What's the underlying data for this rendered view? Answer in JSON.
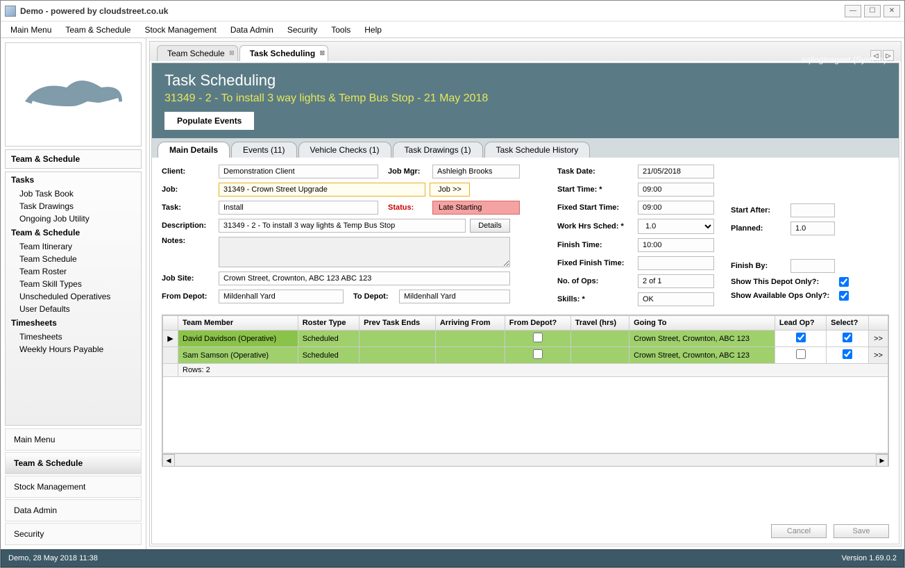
{
  "window": {
    "title": "Demo - powered by cloudstreet.co.uk"
  },
  "menu": [
    "Main Menu",
    "Team & Schedule",
    "Stock Management",
    "Data Admin",
    "Security",
    "Tools",
    "Help"
  ],
  "sidebar": {
    "title": "Team & Schedule",
    "groups": [
      {
        "title": "Tasks",
        "items": [
          "Job Task Book",
          "Task Drawings",
          "Ongoing Job Utility"
        ]
      },
      {
        "title": "Team & Schedule",
        "items": [
          "Team Itinerary",
          "Team Schedule",
          "Team Roster",
          "Team Skill Types",
          "Unscheduled Operatives",
          "User Defaults"
        ]
      },
      {
        "title": "Timesheets",
        "items": [
          "Timesheets",
          "Weekly Hours Payable"
        ]
      }
    ],
    "bottom": [
      "Main Menu",
      "Team & Schedule",
      "Stock Management",
      "Data Admin",
      "Security"
    ]
  },
  "tabs": [
    {
      "label": "Team Schedule",
      "active": false
    },
    {
      "label": "Task Scheduling",
      "active": true
    }
  ],
  "header": {
    "title": "Task Scheduling",
    "subtitle": "31349 - 2 - To install 3 way lights & Temp Bus Stop - 21 May 2018",
    "user": "sqlloginagent (System)",
    "populate": "Populate Events"
  },
  "subtabs": [
    "Main Details",
    "Events (11)",
    "Vehicle Checks (1)",
    "Task Drawings (1)",
    "Task Schedule History"
  ],
  "labels": {
    "client": "Client:",
    "job": "Job:",
    "task": "Task:",
    "description": "Description:",
    "notes": "Notes:",
    "jobsite": "Job Site:",
    "fromdepot": "From Depot:",
    "jobmgr": "Job Mgr:",
    "status": "Status:",
    "todepot": "To Depot:",
    "jobbtn": "Job >>",
    "detailsbtn": "Details",
    "taskdate": "Task Date:",
    "starttime": "Start Time: *",
    "fixedstart": "Fixed Start Time:",
    "workhrs": "Work Hrs Sched: *",
    "finishtime": "Finish Time:",
    "fixedfinish": "Fixed Finish Time:",
    "noops": "No. of Ops:",
    "skills": "Skills: *",
    "startafter": "Start After:",
    "planned": "Planned:",
    "finishby": "Finish By:",
    "showdepot": "Show This Depot Only?:",
    "showavail": "Show Available Ops Only?:",
    "cancel": "Cancel",
    "save": "Save"
  },
  "values": {
    "client": "Demonstration Client",
    "job": "31349 - Crown Street Upgrade",
    "task": "Install",
    "description": "31349 - 2 - To install 3 way lights & Temp Bus Stop",
    "jobsite": "Crown Street, Crownton, ABC 123 ABC 123",
    "fromdepot": "Mildenhall Yard",
    "todepot": "Mildenhall Yard",
    "jobmgr": "Ashleigh Brooks",
    "status": "Late Starting",
    "taskdate": "21/05/2018",
    "starttime": "09:00",
    "fixedstart": "09:00",
    "workhrs": "1.0",
    "finishtime": "10:00",
    "fixedfinish": "",
    "noops": "2 of 1",
    "skills": "OK",
    "startafter": "",
    "planned": "1.0",
    "finishby": ""
  },
  "grid": {
    "headers": [
      "",
      "Team Member",
      "Roster Type",
      "Prev Task Ends",
      "Arriving From",
      "From Depot?",
      "Travel (hrs)",
      "Going To",
      "Lead Op?",
      "Select?",
      ""
    ],
    "rows": [
      {
        "member": "David Davidson (Operative)",
        "roster": "Scheduled",
        "prev": "",
        "arriving": "",
        "fromdepot": false,
        "travel": "",
        "going": "Crown Street, Crownton, ABC 123",
        "lead": true,
        "select": true
      },
      {
        "member": "Sam Samson (Operative)",
        "roster": "Scheduled",
        "prev": "",
        "arriving": "",
        "fromdepot": false,
        "travel": "",
        "going": "Crown Street, Crownton, ABC 123",
        "lead": false,
        "select": true
      }
    ],
    "footer": "Rows: 2",
    "morebtn": ">>"
  },
  "statusbar": {
    "left": "Demo, 28 May 2018 11:38",
    "right": "Version 1.69.0.2"
  }
}
